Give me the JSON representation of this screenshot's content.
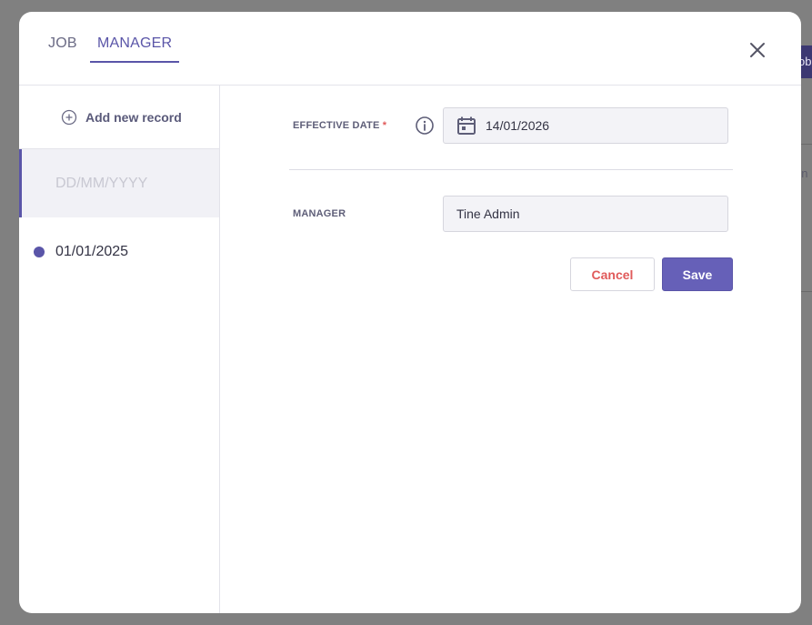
{
  "tabs": {
    "job": "JOB",
    "manager": "MANAGER"
  },
  "background": {
    "chip_text": "ob",
    "side_text": "en"
  },
  "sidebar": {
    "add_record": "Add new record",
    "new_record_placeholder": "DD/MM/YYYY",
    "records": [
      {
        "date": "01/01/2025"
      }
    ]
  },
  "form": {
    "effective_date_label": "EFFECTIVE DATE",
    "required_mark": "*",
    "effective_date_value": "14/01/2026",
    "manager_label": "MANAGER",
    "manager_value": "Tine Admin"
  },
  "actions": {
    "cancel": "Cancel",
    "save": "Save"
  },
  "colors": {
    "accent": "#5a55a8",
    "danger": "#e05a5a"
  },
  "icons": [
    "close-icon",
    "add-circle-icon",
    "info-icon",
    "calendar-icon"
  ]
}
